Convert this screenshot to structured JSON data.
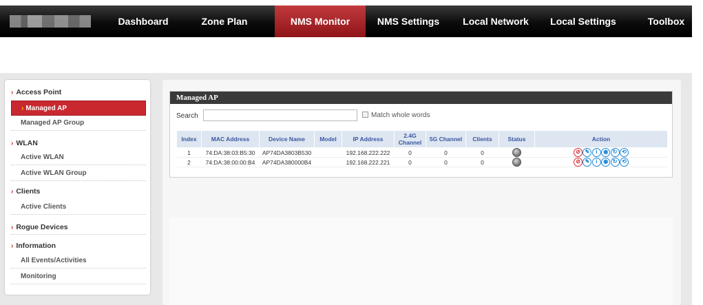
{
  "nav": {
    "items": [
      "Dashboard",
      "Zone Plan",
      "NMS Monitor",
      "NMS Settings",
      "Local Network",
      "Local Settings",
      "Toolbox"
    ],
    "active": "NMS Monitor"
  },
  "sidebar": {
    "access_point": "Access Point",
    "managed_ap": "Managed AP",
    "managed_ap_group": "Managed AP Group",
    "wlan": "WLAN",
    "active_wlan": "Active WLAN",
    "active_wlan_group": "Active WLAN Group",
    "clients": "Clients",
    "active_clients": "Active Clients",
    "rogue_devices": "Rogue Devices",
    "information": "Information",
    "all_events": "All Events/Activities",
    "monitoring": "Monitoring"
  },
  "panel": {
    "title": "Managed AP",
    "search_label": "Search",
    "search_value": "",
    "match_whole_words": "Match whole words"
  },
  "table": {
    "headers": {
      "index": "Index",
      "mac": "MAC Address",
      "device": "Device Name",
      "model": "Model",
      "ip": "IP Address",
      "ch24_a": "2.4G",
      "ch24_b": "Channel",
      "ch5": "5G Channel",
      "clients": "Clients",
      "status": "Status",
      "action": "Action"
    },
    "rows": [
      {
        "index": "1",
        "mac": "74:DA:38:03:B5:30",
        "device": "AP74DA3803B530",
        "model": "",
        "ip": "192.168.222.222",
        "ch24": "0",
        "ch5": "0",
        "clients": "0"
      },
      {
        "index": "2",
        "mac": "74:DA:38:00:00:B4",
        "device": "AP74DA380000B4",
        "model": "",
        "ip": "192.168.222.221",
        "ch24": "0",
        "ch5": "0",
        "clients": "0"
      }
    ],
    "action_icons": [
      "disable-icon",
      "edit-icon",
      "info-icon",
      "blink-icon",
      "restart-icon",
      "reset-icon"
    ],
    "action_glyphs": [
      "⊘",
      "✎",
      "i",
      "◉",
      "↻",
      "⟲"
    ]
  },
  "colors": {
    "accent_red": "#c9282f",
    "link_blue": "#2a4a9c",
    "header_blue_bg": "#dde6f1",
    "icon_blue": "#1a86d8"
  }
}
